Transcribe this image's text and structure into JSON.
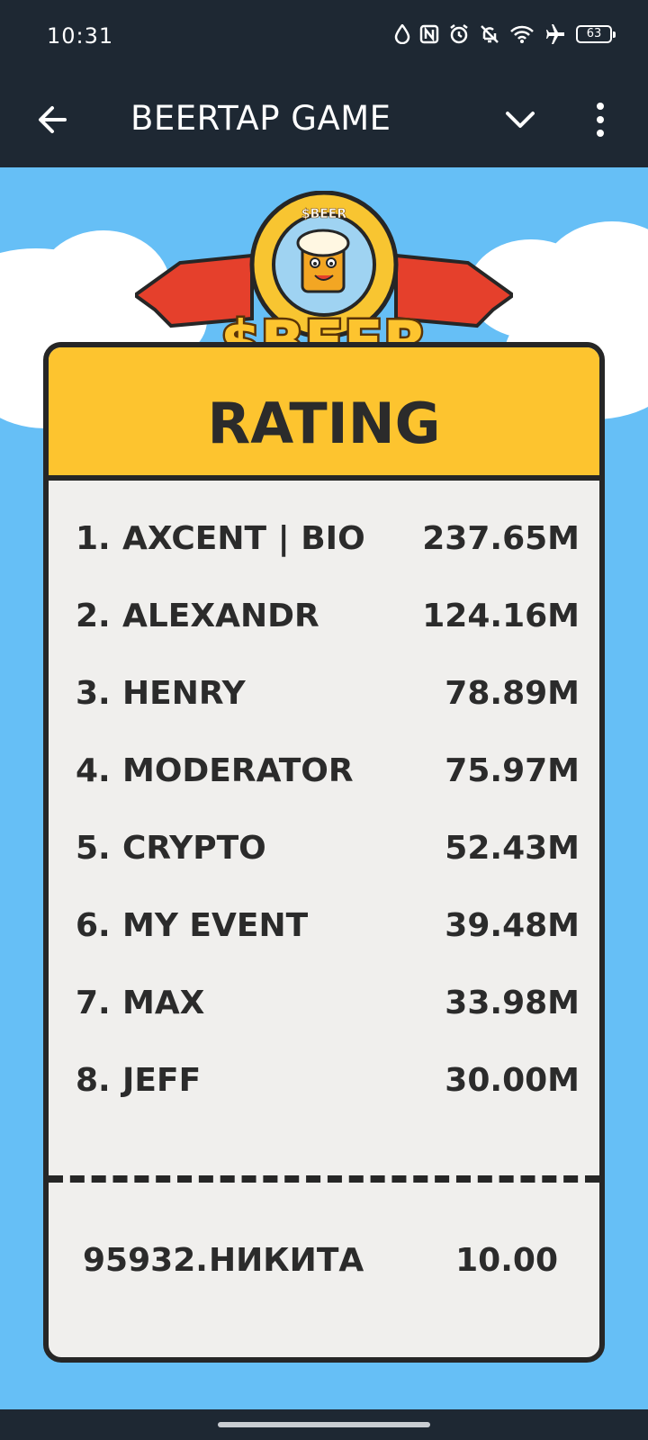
{
  "status_bar": {
    "time": "10:31",
    "battery": "63",
    "icons": [
      "droplet-icon",
      "nfc-icon",
      "alarm-icon",
      "bell-off-icon",
      "wifi-icon",
      "airplane-icon",
      "battery-icon"
    ]
  },
  "app_bar": {
    "title": "BEERTAP GAME",
    "back_icon": "arrow-left-icon",
    "collapse_icon": "chevron-down-icon",
    "menu_icon": "more-vertical-icon"
  },
  "logo": {
    "text": "$BEER",
    "ring_text": "$BEER"
  },
  "card": {
    "title": "RATING",
    "leaderboard": [
      {
        "rank": "1.",
        "name": "AXCENT | BIO",
        "score": "237.65M"
      },
      {
        "rank": "2.",
        "name": "ALEXANDR",
        "score": "124.16M"
      },
      {
        "rank": "3.",
        "name": "HENRY",
        "score": "78.89M"
      },
      {
        "rank": "4.",
        "name": "MODERATOR",
        "score": "75.97M"
      },
      {
        "rank": "5.",
        "name": "CRYPTO",
        "score": "52.43M"
      },
      {
        "rank": "6.",
        "name": "MY EVENT",
        "score": "39.48M"
      },
      {
        "rank": "7.",
        "name": "MAX",
        "score": "33.98M"
      },
      {
        "rank": "8.",
        "name": "JEFF",
        "score": "30.00M"
      }
    ],
    "current_user": {
      "rank": "95932.",
      "name": "НИКИТА",
      "score": "10.00"
    }
  },
  "colors": {
    "bar": "#1e2833",
    "sky": "#66bff6",
    "header_yellow": "#fdc42f",
    "card_bg": "#f0efed",
    "ribbon": "#e5402c"
  }
}
